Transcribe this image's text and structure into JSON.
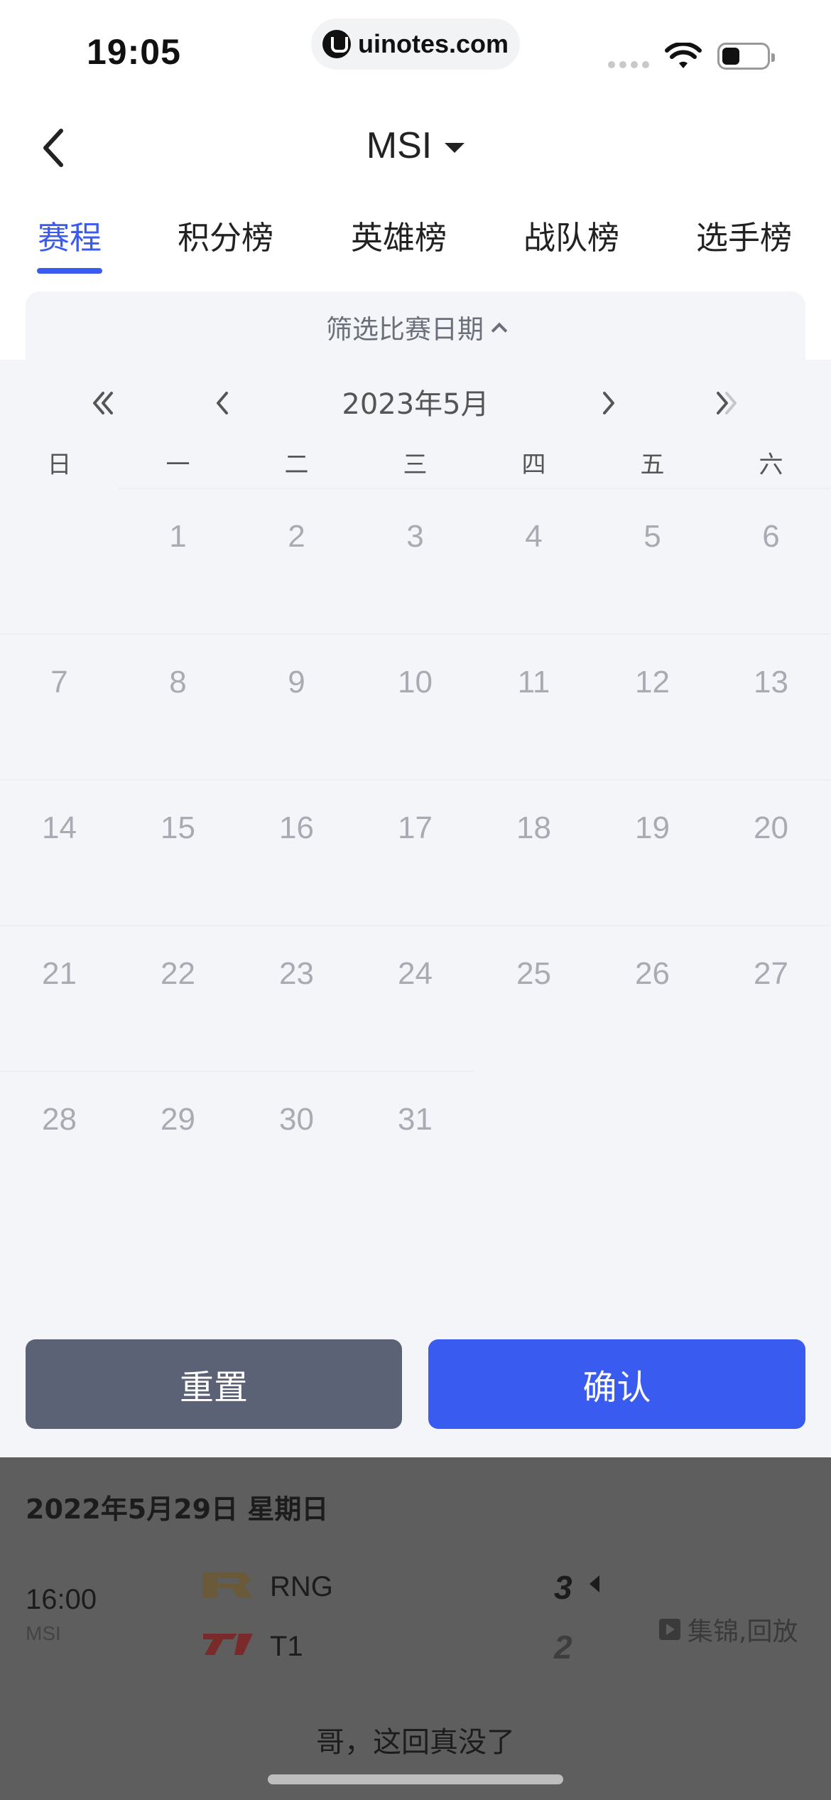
{
  "status_bar": {
    "time": "19:05",
    "url": "uinotes.com"
  },
  "header": {
    "title": "MSI"
  },
  "tabs": [
    {
      "label": "赛程",
      "active": true
    },
    {
      "label": "积分榜",
      "active": false
    },
    {
      "label": "英雄榜",
      "active": false
    },
    {
      "label": "战队榜",
      "active": false
    },
    {
      "label": "选手榜",
      "active": false
    }
  ],
  "filter": {
    "label": "筛选比赛日期",
    "month_label": "2023年5月",
    "weekdays": [
      "日",
      "一",
      "二",
      "三",
      "四",
      "五",
      "六"
    ],
    "days": [
      [
        "",
        "1",
        "2",
        "3",
        "4",
        "5",
        "6"
      ],
      [
        "7",
        "8",
        "9",
        "10",
        "11",
        "12",
        "13"
      ],
      [
        "14",
        "15",
        "16",
        "17",
        "18",
        "19",
        "20"
      ],
      [
        "21",
        "22",
        "23",
        "24",
        "25",
        "26",
        "27"
      ],
      [
        "28",
        "29",
        "30",
        "31",
        "",
        "",
        ""
      ]
    ],
    "reset_label": "重置",
    "confirm_label": "确认"
  },
  "match": {
    "date": "2022年5月29日 星期日",
    "time": "16:00",
    "league": "MSI",
    "team1": {
      "name": "RNG",
      "score": "3"
    },
    "team2": {
      "name": "T1",
      "score": "2"
    },
    "replay_label": "集锦,回放"
  },
  "footer": {
    "text": "哥，这回真没了"
  },
  "colors": {
    "accent": "#3a5bf0",
    "reset_button": "#5c6276",
    "sheet_bg": "#f4f5f8",
    "day_text": "#a8abb3"
  }
}
